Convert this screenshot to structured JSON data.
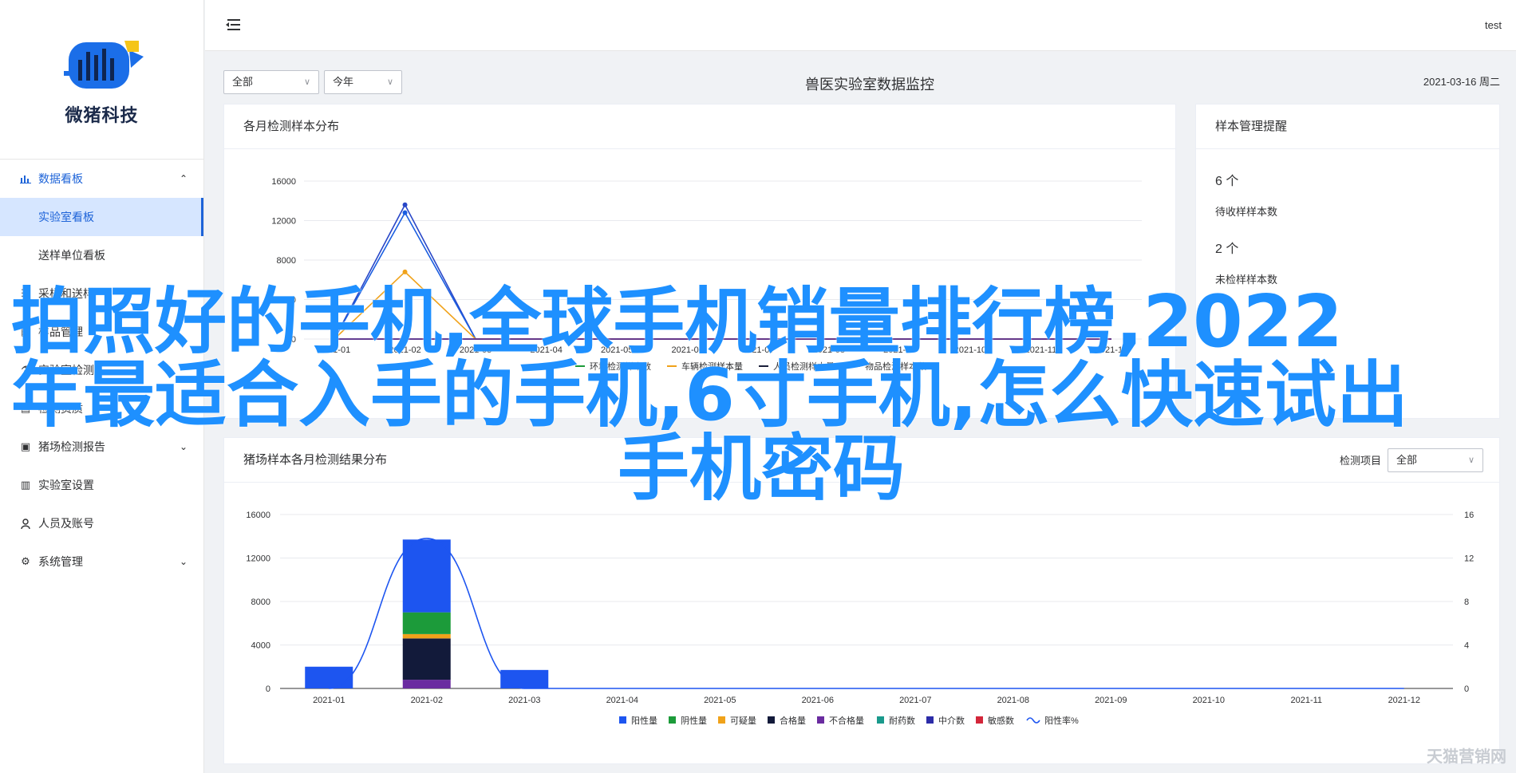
{
  "brand": {
    "name": "微猪科技"
  },
  "user": {
    "name": "test"
  },
  "sidebar": {
    "items": [
      {
        "label": "数据看板",
        "icon": "bar-chart-icon",
        "expanded": true,
        "active": true
      },
      {
        "label": "实验室看板",
        "sub": true,
        "selected": true
      },
      {
        "label": "送样单位看板",
        "sub": true
      },
      {
        "label": "采样和送样",
        "icon": "list-icon"
      },
      {
        "label": "样品管理",
        "icon": "grid-icon"
      },
      {
        "label": "实验室检测",
        "icon": "flask-icon"
      },
      {
        "label": "检测资质",
        "icon": "certificate-icon"
      },
      {
        "label": "猪场检测报告",
        "icon": "report-icon",
        "expandable": true
      },
      {
        "label": "实验室设置",
        "icon": "settings-doc-icon"
      },
      {
        "label": "人员及账号",
        "icon": "user-icon"
      },
      {
        "label": "系统管理",
        "icon": "gear-icon",
        "expandable": true
      }
    ]
  },
  "filters": {
    "scope": "全部",
    "period": "今年"
  },
  "page_title": "兽医实验室数据监控",
  "date": "2021-03-16 周二",
  "panel_monthly": {
    "title": "各月检测样本分布"
  },
  "panel_reminder": {
    "title": "样本管理提醒",
    "items": [
      {
        "count": "6 个",
        "label": "待收样样本数"
      },
      {
        "count": "2 个",
        "label": "未检样样本数"
      }
    ]
  },
  "panel_results": {
    "title": "猪场样本各月检测结果分布",
    "filter_label": "检测项目",
    "filter_value": "全部"
  },
  "overlay": {
    "line1": "拍照好的手机,全球手机销量排行榜,2022",
    "line2": "年最适合入手的手机,6寸手机,怎么快速试出",
    "line3": "手机密码"
  },
  "watermark": "天猫营销网",
  "colors": {
    "accent": "#1d63d8",
    "overlay": "#1e90ff"
  },
  "chart_data": [
    {
      "type": "line",
      "title": "各月检测样本分布",
      "x": [
        "2021-01",
        "2021-02",
        "2021-03",
        "2021-04",
        "2021-05",
        "2021-06",
        "2021-07",
        "2021-08",
        "2021-09",
        "2021-10",
        "2021-11",
        "2021-12"
      ],
      "ylim": [
        0,
        16000
      ],
      "yticks": [
        0,
        4000,
        8000,
        12000,
        16000
      ],
      "grid": true,
      "series": [
        {
          "name": "",
          "color": "#2947c8",
          "values": [
            0,
            13600,
            0,
            0,
            0,
            0,
            0,
            0,
            0,
            0,
            0,
            0
          ]
        },
        {
          "name": "",
          "color": "#1b5ee0",
          "values": [
            0,
            12800,
            0,
            0,
            0,
            0,
            0,
            0,
            0,
            0,
            0,
            0
          ]
        },
        {
          "name": "环境检测样本数",
          "color": "#1c9b3a",
          "values": [
            0,
            0,
            0,
            0,
            0,
            0,
            0,
            0,
            0,
            0,
            0,
            0
          ]
        },
        {
          "name": "车辆检测样本量",
          "color": "#f0a21a",
          "values": [
            0,
            6800,
            0,
            0,
            0,
            0,
            0,
            0,
            0,
            0,
            0,
            0
          ]
        },
        {
          "name": "人员检测样本量",
          "color": "#1a1f3a",
          "values": [
            0,
            0,
            0,
            0,
            0,
            0,
            0,
            0,
            0,
            0,
            0,
            0
          ]
        },
        {
          "name": "物品检测样本数",
          "color": "#6a2ca0",
          "values": [
            0,
            0,
            0,
            0,
            0,
            0,
            0,
            0,
            0,
            0,
            0,
            0
          ]
        }
      ]
    },
    {
      "type": "bar",
      "title": "猪场样本各月检测结果分布",
      "categories": [
        "2021-01",
        "2021-02",
        "2021-03",
        "2021-04",
        "2021-05",
        "2021-06",
        "2021-07",
        "2021-08",
        "2021-09",
        "2021-10",
        "2021-11",
        "2021-12"
      ],
      "ylim": [
        0,
        16000
      ],
      "yticks": [
        0,
        4000,
        8000,
        12000,
        16000
      ],
      "y2lim": [
        0,
        16
      ],
      "y2ticks": [
        0,
        4,
        8,
        12,
        16
      ],
      "stacked": true,
      "legend_position": "bottom",
      "series": [
        {
          "name": "阳性量",
          "color": "#1d55f0",
          "values": [
            2000,
            6700,
            1700,
            0,
            0,
            0,
            0,
            0,
            0,
            0,
            0,
            0
          ]
        },
        {
          "name": "阴性量",
          "color": "#1c9b3a",
          "values": [
            0,
            2000,
            0,
            0,
            0,
            0,
            0,
            0,
            0,
            0,
            0,
            0
          ]
        },
        {
          "name": "可疑量",
          "color": "#f0a21a",
          "values": [
            0,
            400,
            0,
            0,
            0,
            0,
            0,
            0,
            0,
            0,
            0,
            0
          ]
        },
        {
          "name": "合格量",
          "color": "#121a3a",
          "values": [
            0,
            3800,
            0,
            0,
            0,
            0,
            0,
            0,
            0,
            0,
            0,
            0
          ]
        },
        {
          "name": "不合格量",
          "color": "#6a2ca0",
          "values": [
            0,
            800,
            0,
            0,
            0,
            0,
            0,
            0,
            0,
            0,
            0,
            0
          ]
        },
        {
          "name": "耐药数",
          "color": "#1a9a8c",
          "values": [
            0,
            0,
            0,
            0,
            0,
            0,
            0,
            0,
            0,
            0,
            0,
            0
          ]
        },
        {
          "name": "中介数",
          "color": "#2c2ca8",
          "values": [
            0,
            0,
            0,
            0,
            0,
            0,
            0,
            0,
            0,
            0,
            0,
            0
          ]
        },
        {
          "name": "敏感数",
          "color": "#d3263a",
          "values": [
            0,
            0,
            0,
            0,
            0,
            0,
            0,
            0,
            0,
            0,
            0,
            0
          ]
        }
      ],
      "line_series": {
        "name": "阳性率%",
        "color": "#1d55f0",
        "axis": "right",
        "values": [
          0,
          13.8,
          0,
          0,
          0,
          0,
          0,
          0,
          0,
          0,
          0,
          0
        ]
      }
    }
  ]
}
